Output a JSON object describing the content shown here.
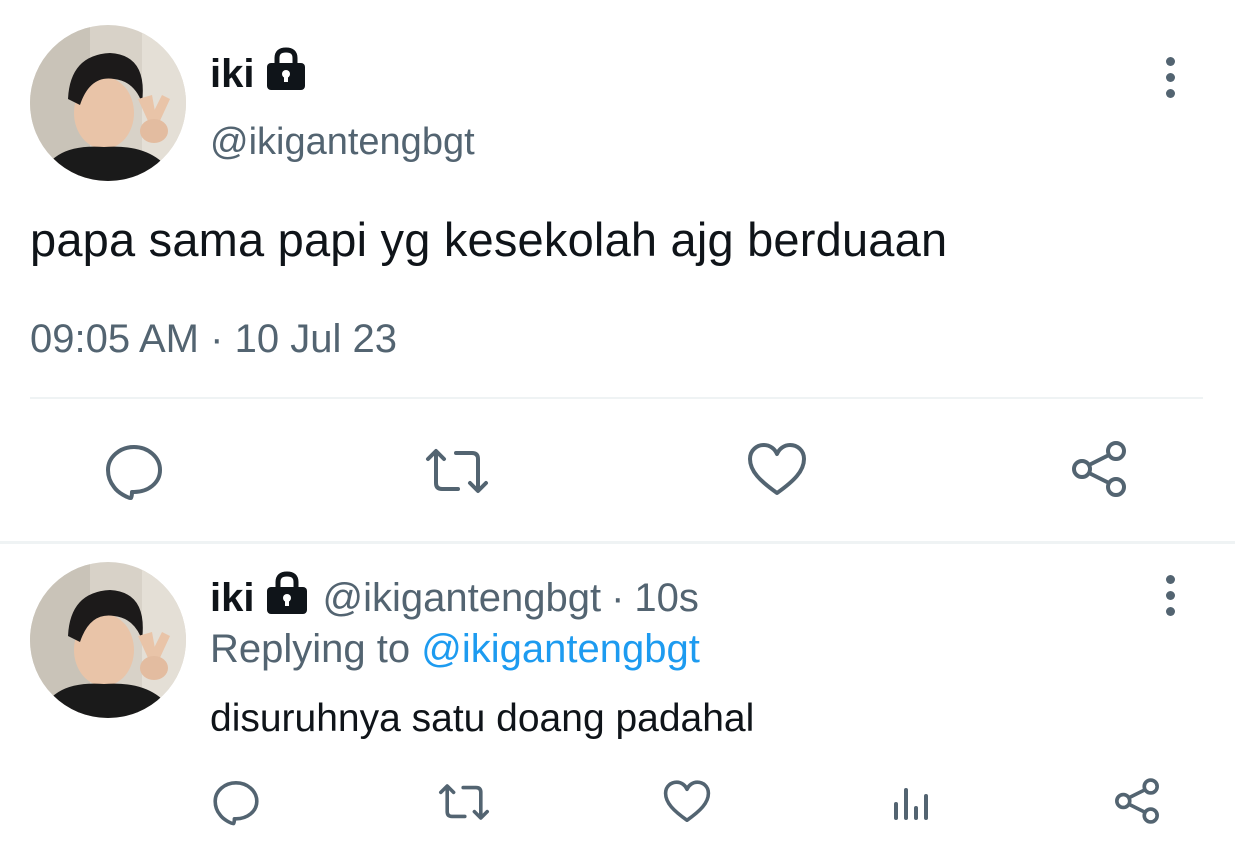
{
  "main_tweet": {
    "display_name": "iki",
    "handle": "@ikigantengbgt",
    "text": "papa sama papi yg kesekolah ajg berduaan",
    "time": "09:05 AM",
    "separator": "·",
    "date": "10 Jul 23",
    "icons": {
      "protected": "lock-icon",
      "menu": "more-vertical-icon",
      "reply": "reply-icon",
      "retweet": "retweet-icon",
      "like": "heart-icon",
      "share": "share-icon"
    }
  },
  "reply_tweet": {
    "display_name": "iki",
    "handle": "@ikigantengbgt",
    "separator": "·",
    "time_ago": "10s",
    "replying_prefix": "Replying to",
    "replying_handle": "@ikigantengbgt",
    "text": "disuruhnya satu doang padahal",
    "icons": {
      "protected": "lock-icon",
      "menu": "more-vertical-icon",
      "reply": "reply-icon",
      "retweet": "retweet-icon",
      "like": "heart-icon",
      "views": "analytics-icon",
      "share": "share-icon"
    }
  },
  "colors": {
    "text_primary": "#0f1419",
    "text_secondary": "#536471",
    "link": "#1d9bf0",
    "divider": "#eff3f4"
  }
}
